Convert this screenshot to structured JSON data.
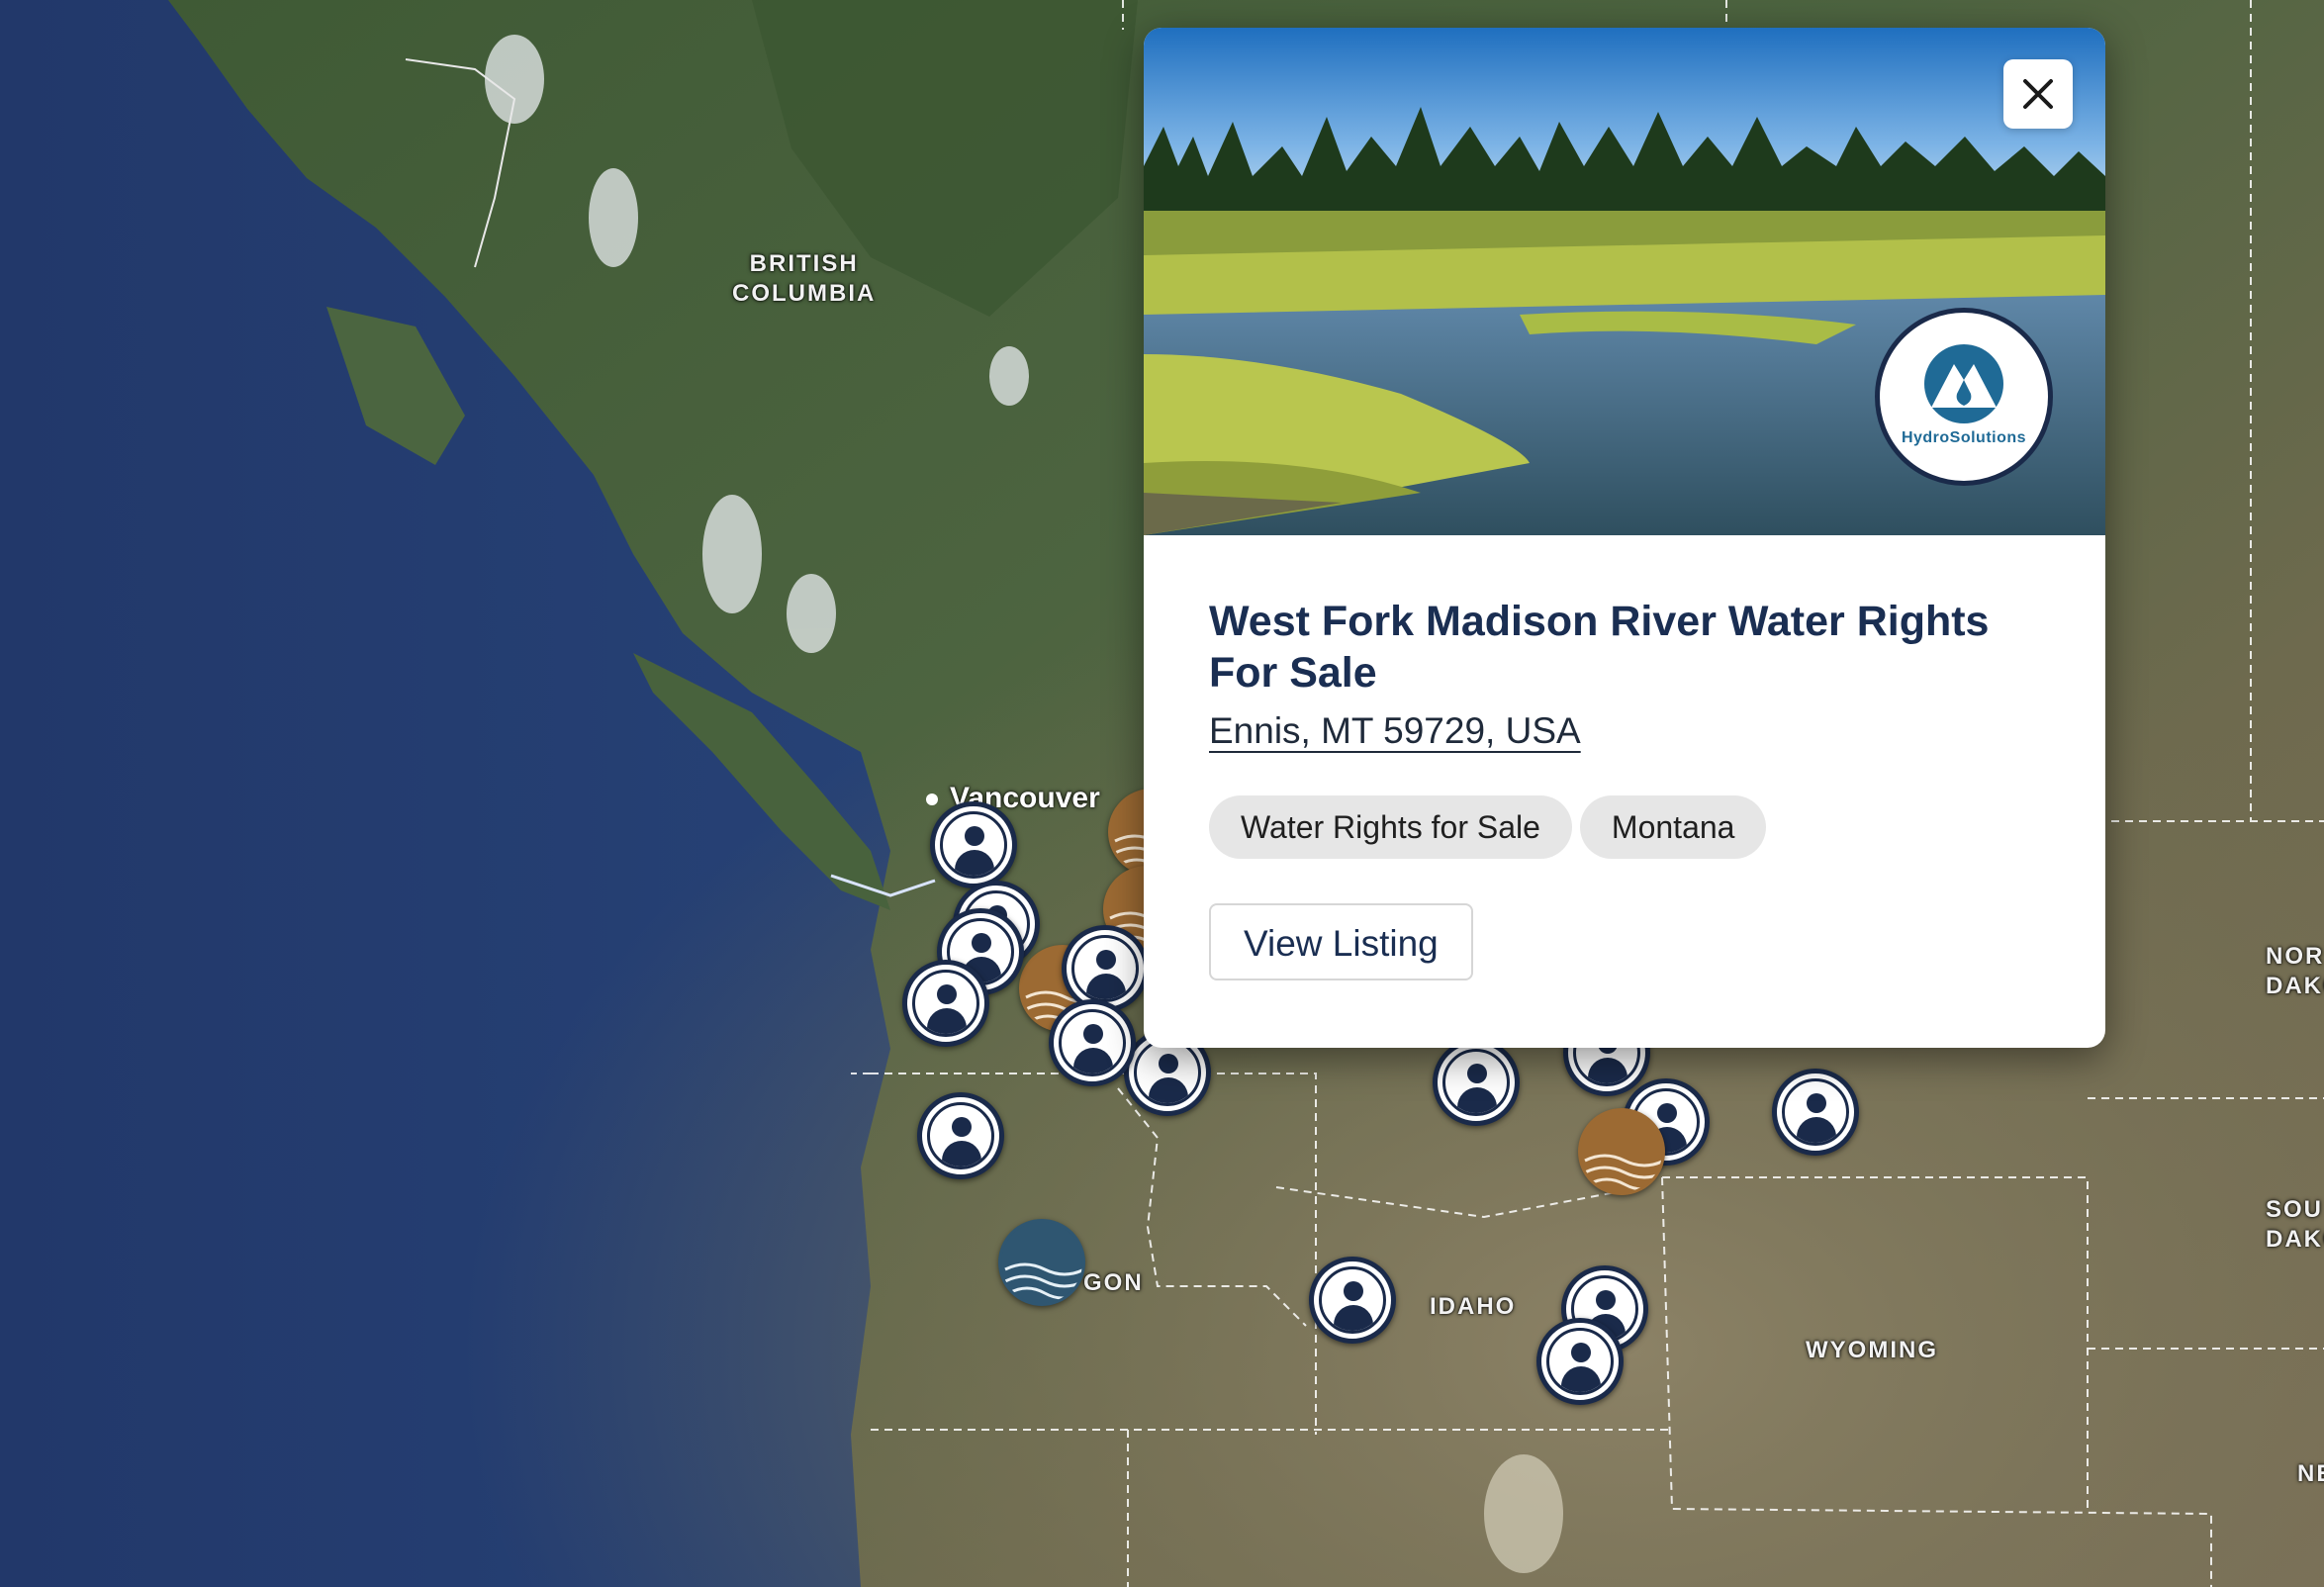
{
  "map": {
    "region_labels": [
      "BRITISH\nCOLUMBIA",
      "IDAHO",
      "WYOMING",
      "GON",
      "NOR\nDAKO",
      "SOU\nDAKO",
      "NE"
    ],
    "city_label": "Vancouver"
  },
  "popup": {
    "title": "West Fork Madison River Water Rights For Sale",
    "address": "Ennis, MT 59729, USA",
    "tags": [
      "Water Rights for Sale",
      "Montana"
    ],
    "button_label": "View Listing",
    "company_logo_text": "HydroSolutions",
    "close_icon": "close-icon",
    "image_subject": "river-meadow-forest-photo"
  },
  "markers": {
    "types": [
      "user",
      "water",
      "land"
    ],
    "colors": {
      "user": "#1a2a4a",
      "water": "#2f5671",
      "land": "#9c6a33"
    }
  }
}
